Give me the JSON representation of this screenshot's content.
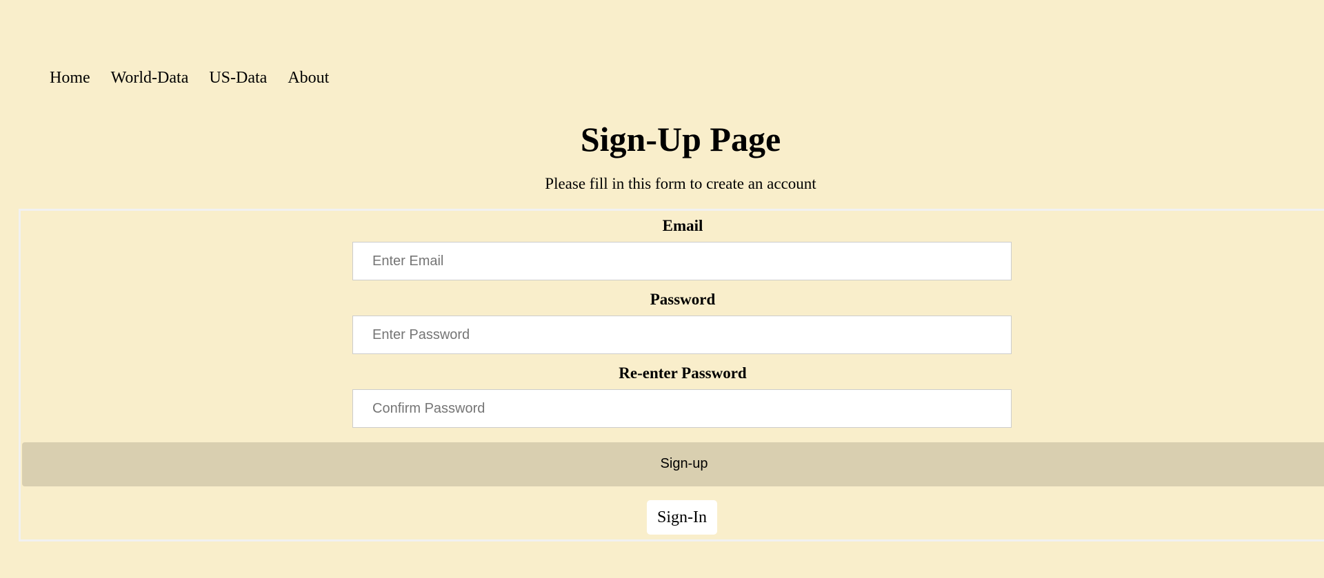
{
  "nav": {
    "items": [
      {
        "label": "Home"
      },
      {
        "label": "World-Data"
      },
      {
        "label": "US-Data"
      },
      {
        "label": "About"
      }
    ]
  },
  "page": {
    "title": "Sign-Up Page",
    "subtitle": "Please fill in this form to create an account"
  },
  "form": {
    "email": {
      "label": "Email",
      "placeholder": "Enter Email",
      "value": ""
    },
    "password": {
      "label": "Password",
      "placeholder": "Enter Password",
      "value": ""
    },
    "confirm": {
      "label": "Re-enter Password",
      "placeholder": "Confirm Password",
      "value": ""
    },
    "signup_label": "Sign-up",
    "signin_label": "Sign-In"
  },
  "colors": {
    "background": "#f9eecb",
    "signup_button": "#d9cfb0",
    "form_border": "#f1f1f1"
  }
}
